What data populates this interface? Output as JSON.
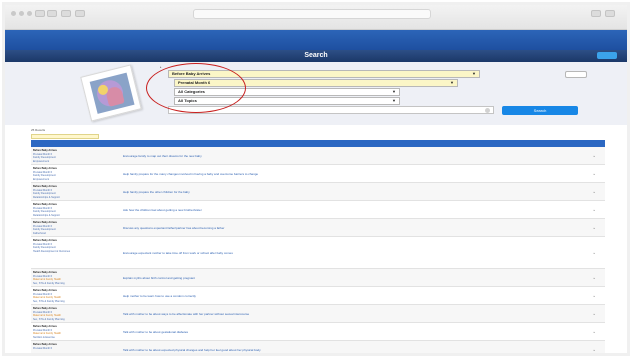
{
  "browser": {
    "url": "",
    "bookmarks": ""
  },
  "site": {
    "brand": "",
    "brand_sub": "",
    "links": [
      "",
      ""
    ]
  },
  "search": {
    "title": "Search",
    "help_label": "",
    "clear_label": "",
    "go_label": "Search",
    "keyword_placeholder": ""
  },
  "filters": [
    {
      "value": "Before Baby Arrives"
    },
    {
      "value": "Prenatal Month 6"
    },
    {
      "value": "All Categories"
    },
    {
      "value": "All Topics"
    }
  ],
  "results": {
    "count_label": "25 Results",
    "toggle_label": "",
    "headers": [
      "",
      "",
      "",
      ""
    ],
    "rows": [
      {
        "lines": [
          {
            "text": "Before Baby Arrives",
            "kind": "t"
          },
          {
            "text": "Prenatal Month 6",
            "kind": "n"
          },
          {
            "text": "Family Development",
            "kind": "n"
          },
          {
            "text": "Empowerment",
            "kind": "n"
          }
        ],
        "title": "Encourage family to map out their dreams for the new baby",
        "resources": [
          ""
        ]
      },
      {
        "lines": [
          {
            "text": "Before Baby Arrives",
            "kind": "t"
          },
          {
            "text": "Prenatal Month 6",
            "kind": "n"
          },
          {
            "text": "Family Development",
            "kind": "n"
          },
          {
            "text": "Empowerment",
            "kind": "n"
          }
        ],
        "title": "Help family prepare for the many changes involved in having a baby and overcome barriers to change",
        "resources": [
          "",
          "",
          ""
        ]
      },
      {
        "lines": [
          {
            "text": "Before Baby Arrives",
            "kind": "t"
          },
          {
            "text": "Prenatal Month 6",
            "kind": "n"
          },
          {
            "text": "Family Development",
            "kind": "n"
          },
          {
            "text": "Relationships & Support",
            "kind": "n"
          }
        ],
        "title": "Help family prepare the other children for the baby",
        "resources": [
          ""
        ]
      },
      {
        "lines": [
          {
            "text": "Before Baby Arrives",
            "kind": "t"
          },
          {
            "text": "Prenatal Month 6",
            "kind": "n"
          },
          {
            "text": "Family Development",
            "kind": "n"
          },
          {
            "text": "Relationships & Support",
            "kind": "n"
          }
        ],
        "title": "Ask how the children feel about getting a new brother/sister",
        "resources": [
          ""
        ]
      },
      {
        "lines": [
          {
            "text": "Before Baby Arrives",
            "kind": "t"
          },
          {
            "text": "Prenatal Month 6",
            "kind": "n"
          },
          {
            "text": "Family Development",
            "kind": "n"
          },
          {
            "text": "Fatherhood",
            "kind": "n"
          }
        ],
        "title": "Discuss any questions expectant father/partner has about becoming a father",
        "resources": [
          "",
          "",
          "",
          ""
        ]
      },
      {
        "lines": [
          {
            "text": "Before Baby Arrives",
            "kind": "t"
          },
          {
            "text": "Prenatal Month 6",
            "kind": "n"
          },
          {
            "text": "Family Development",
            "kind": "n"
          },
          {
            "text": "Health Development & Outcomes",
            "kind": "n"
          }
        ],
        "title": "Encourage expectant mother to take time off from work or school after baby comes",
        "resources": [
          "",
          "",
          "",
          "",
          "",
          "",
          "",
          ""
        ]
      },
      {
        "lines": [
          {
            "text": "Before Baby Arrives",
            "kind": "t"
          },
          {
            "text": "Prenatal Month 6",
            "kind": "n"
          },
          {
            "text": "Maternal & Family Health",
            "kind": "o"
          },
          {
            "text": "Sex, STIs & Family Planning",
            "kind": "n"
          }
        ],
        "title": "Explain myths about birth control and getting pregnant",
        "resources": [
          "",
          "",
          ""
        ]
      },
      {
        "lines": [
          {
            "text": "Before Baby Arrives",
            "kind": "t"
          },
          {
            "text": "Prenatal Month 6",
            "kind": "n"
          },
          {
            "text": "Maternal & Family Health",
            "kind": "o"
          },
          {
            "text": "Sex, STIs & Family Planning",
            "kind": "n"
          }
        ],
        "title": "Help mother to be learn how to use a condom correctly",
        "resources": [
          "",
          "",
          ""
        ]
      },
      {
        "lines": [
          {
            "text": "Before Baby Arrives",
            "kind": "t"
          },
          {
            "text": "Prenatal Month 6",
            "kind": "n"
          },
          {
            "text": "Maternal & Family Health",
            "kind": "o"
          },
          {
            "text": "Sex, STIs & Family Planning",
            "kind": "n"
          }
        ],
        "title": "Talk with mother to be about ways to be affectionate with her partner without sexual intercourse",
        "resources": [
          "",
          ""
        ]
      },
      {
        "lines": [
          {
            "text": "Before Baby Arrives",
            "kind": "t"
          },
          {
            "text": "Prenatal Month 6",
            "kind": "n"
          },
          {
            "text": "Maternal & Family Health",
            "kind": "o"
          },
          {
            "text": "Nutrition & Exercise",
            "kind": "n"
          }
        ],
        "title": "Talk with mother to be about gestational diabetes",
        "resources": [
          ""
        ]
      },
      {
        "lines": [
          {
            "text": "Before Baby Arrives",
            "kind": "t"
          },
          {
            "text": "Prenatal Month 6",
            "kind": "n"
          }
        ],
        "title": "Talk with mother to be about expected physical changes and help her feel good about her physical body",
        "resources": [
          "",
          ""
        ]
      }
    ]
  },
  "dock_items": [
    "",
    "",
    "",
    "",
    "",
    "",
    ""
  ]
}
